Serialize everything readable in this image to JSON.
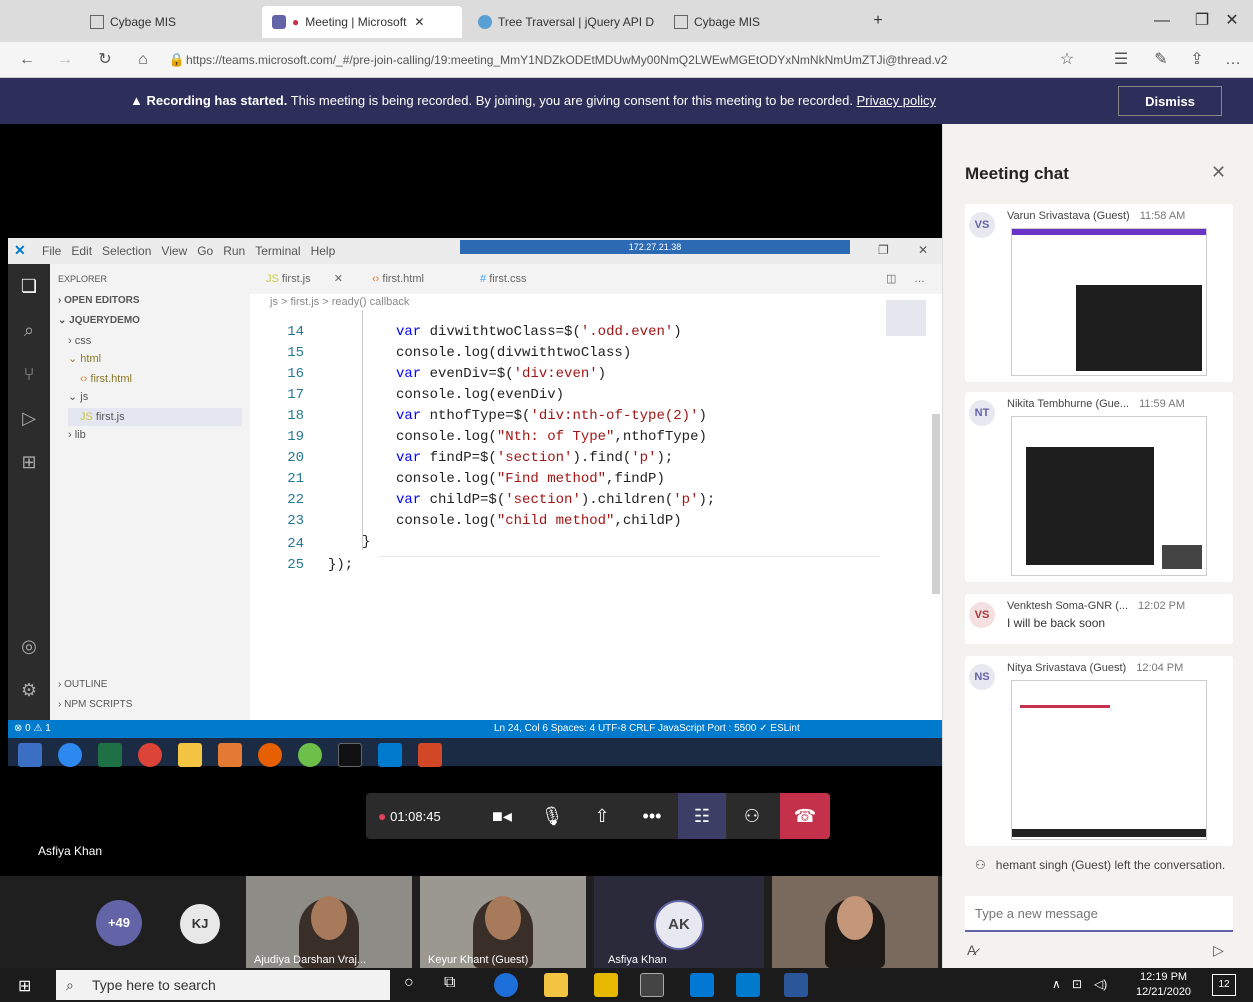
{
  "browser": {
    "tabs": [
      {
        "label": "Cybage MIS"
      },
      {
        "label": "Meeting | Microsoft"
      },
      {
        "label": "Tree Traversal | jQuery API D"
      },
      {
        "label": "Cybage MIS"
      }
    ],
    "url": "https://teams.microsoft.com/_#/pre-join-calling/19:meeting_MmY1NDZkODEtMDUwMy00NmQ2LWEwMGEtODYxNmNkNmUmZTJi@thread.v2"
  },
  "banner": {
    "bold": "Recording has started.",
    "text": " This meeting is being recorded. By joining, you are giving consent for this meeting to be recorded. ",
    "link": "Privacy policy",
    "dismiss": "Dismiss"
  },
  "vscode": {
    "menu": [
      "File",
      "Edit",
      "Selection",
      "View",
      "Go",
      "Run",
      "Terminal",
      "Help"
    ],
    "remote_title": "172.27.21.38",
    "explorer": {
      "header": "EXPLORER",
      "open_editors": "OPEN EDITORS",
      "project": "JQUERYDEMO",
      "items": [
        "css",
        "html",
        "first.html",
        "js",
        "first.js",
        "lib"
      ],
      "outline": "OUTLINE",
      "npm": "NPM SCRIPTS"
    },
    "tabs": [
      "first.js",
      "first.html",
      "first.css"
    ],
    "breadcrumb": "js > first.js > ready() callback",
    "lines": [
      {
        "n": "14",
        "code": "var divwithtwoClass=$('.odd.even')"
      },
      {
        "n": "15",
        "code": "console.log(divwithtwoClass)"
      },
      {
        "n": "16",
        "code": "var evenDiv=$('div:even')"
      },
      {
        "n": "17",
        "code": "console.log(evenDiv)"
      },
      {
        "n": "18",
        "code": "var nthofType=$('div:nth-of-type(2)')"
      },
      {
        "n": "19",
        "code": "console.log(\"Nth: of Type\",nthofType)"
      },
      {
        "n": "20",
        "code": "var findP=$('section').find('p');"
      },
      {
        "n": "21",
        "code": "console.log(\"Find method\",findP)"
      },
      {
        "n": "22",
        "code": "var childP=$('section').children('p');"
      },
      {
        "n": "23",
        "code": "console.log(\"child method\",childP)"
      },
      {
        "n": "24",
        "code": "}"
      },
      {
        "n": "25",
        "code": "});"
      }
    ],
    "status": {
      "left": "⊗ 0 ⚠ 1",
      "right": "Ln 24, Col 6    Spaces: 4    UTF-8    CRLF    JavaScript    Port : 5500    ✓ ESLint"
    }
  },
  "call": {
    "timer": "01:08:45",
    "presenter": "Asfiya Khan"
  },
  "participants": {
    "more": "+49",
    "kj": "KJ",
    "tiles": [
      "Ajudiya Darshan Vraj...",
      "Keyur Khant (Guest)"
    ],
    "ak_initials": "AK",
    "ak_name": "Asfiya Khan"
  },
  "chat": {
    "title": "Meeting chat",
    "messages": [
      {
        "initials": "VS",
        "name": "Varun Srivastava (Guest)",
        "time": "11:58 AM"
      },
      {
        "initials": "NT",
        "name": "Nikita Tembhurne (Gue...",
        "time": "11:59 AM"
      },
      {
        "initials": "VS",
        "name": "Venktesh Soma-GNR (...",
        "time": "12:02 PM",
        "body": "I will be back soon"
      },
      {
        "initials": "NS",
        "name": "Nitya Srivastava (Guest)",
        "time": "12:04 PM"
      }
    ],
    "system": "hemant singh (Guest) left the conversation.",
    "input_placeholder": "Type a new message"
  },
  "taskbar": {
    "search": "Type here to search",
    "time": "12:19 PM",
    "date": "12/21/2020",
    "notif": "12"
  },
  "colors": {
    "teams_purple": "#6264a7",
    "banner_bg": "#2d2f5a",
    "hangup": "#c4314b",
    "vscode_status": "#007acc"
  }
}
